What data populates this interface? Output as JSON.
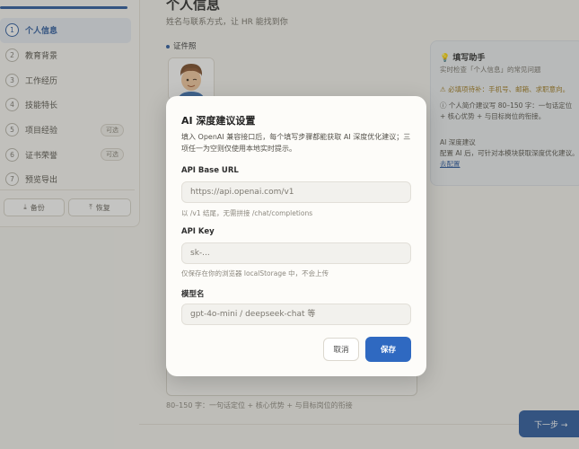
{
  "sidebar": {
    "steps": [
      {
        "num": "1",
        "label": "个人信息",
        "active": true
      },
      {
        "num": "2",
        "label": "教育背景"
      },
      {
        "num": "3",
        "label": "工作经历"
      },
      {
        "num": "4",
        "label": "技能特长"
      },
      {
        "num": "5",
        "label": "项目经验",
        "optional": "可选"
      },
      {
        "num": "6",
        "label": "证书荣誉",
        "optional": "可选"
      },
      {
        "num": "7",
        "label": "预览导出"
      }
    ],
    "backup_label": "备份",
    "restore_label": "恢复"
  },
  "main": {
    "title": "个人信息",
    "subtitle": "姓名与联系方式，让 HR 能找到你",
    "photo_label": "证件照",
    "textarea_hint": "80–150 字：一句话定位 + 核心优势 + 与目标岗位的衔接",
    "next_label": "下一步 →"
  },
  "helper": {
    "title": "填写助手",
    "subtitle": "实时检查「个人信息」的常见问题",
    "warning": "必填项待补：手机号、邮箱、求职意向。",
    "info": "个人简介建议写 80–150 字：一句话定位 + 核心优势 + 与目标岗位的衔接。",
    "ai_section": "AI 深度建议",
    "ai_text": "配置 AI 后，可针对本模块获取深度优化建议。",
    "ai_link": "去配置"
  },
  "modal": {
    "title": "AI 深度建议设置",
    "description": "填入 OpenAI 兼容接口后，每个填写步骤都能获取 AI 深度优化建议；三项任一为空则仅使用本地实时提示。",
    "base_url": {
      "label": "API Base URL",
      "placeholder": "https://api.openai.com/v1",
      "hint": "以 /v1 结尾，无需拼接 /chat/completions"
    },
    "api_key": {
      "label": "API Key",
      "placeholder": "sk-...",
      "hint": "仅保存在你的浏览器 localStorage 中，不会上传"
    },
    "model": {
      "label": "模型名",
      "placeholder": "gpt-4o-mini / deepseek-chat 等"
    },
    "cancel_label": "取消",
    "save_label": "保存"
  },
  "colors": {
    "accent": "#2c5aa0",
    "save": "#2f69c1",
    "warning": "#a07b1f"
  }
}
